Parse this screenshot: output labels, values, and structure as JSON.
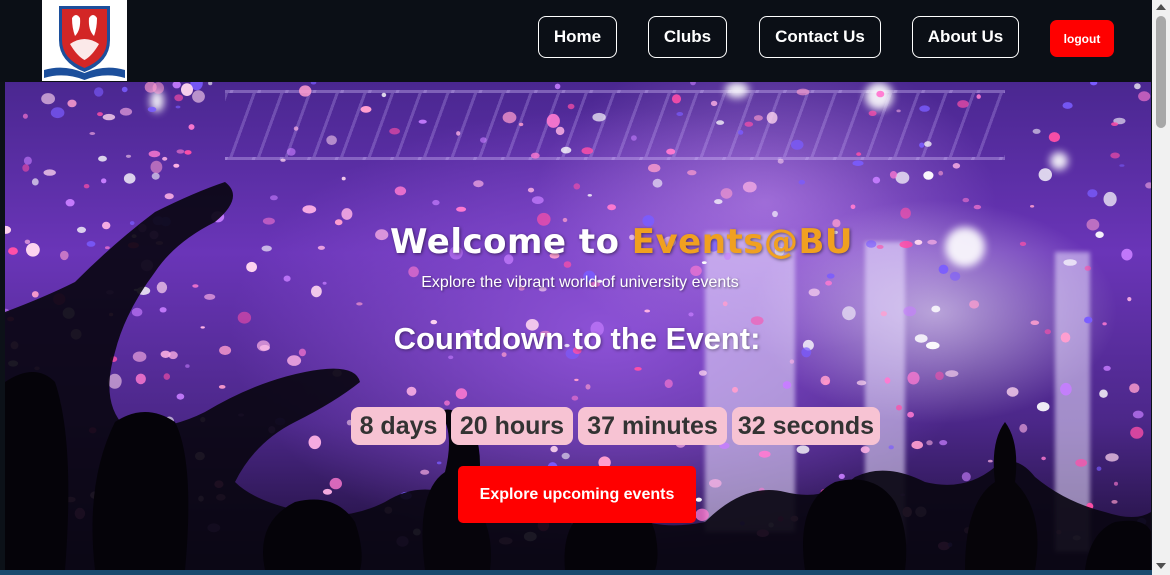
{
  "nav": {
    "logo_icon": "bu-crest-icon",
    "links": [
      "Home",
      "Clubs",
      "Contact Us",
      "About Us"
    ],
    "logout_label": "logout"
  },
  "hero": {
    "welcome_prefix": "Welcome to ",
    "brand": "Events@BU",
    "tagline": "Explore the vibrant world of university events",
    "countdown_title": "Countdown to the Event:",
    "countdown": {
      "days": "8 days",
      "hours": "20 hours",
      "minutes": "37 minutes",
      "seconds": "32 seconds"
    },
    "cta_label": "Explore upcoming events"
  },
  "colors": {
    "navbar": "#0b0f16",
    "brand_accent": "#f0a020",
    "button_red": "#ff0000",
    "countdown_box": "#f7c3d3"
  }
}
